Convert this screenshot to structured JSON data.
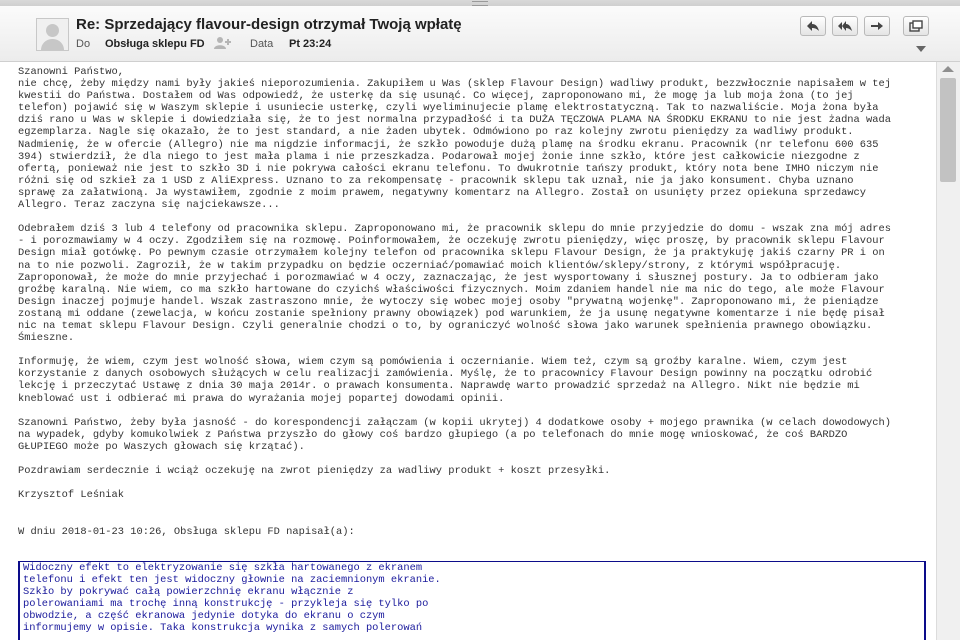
{
  "header": {
    "subject": "Re: Sprzedający flavour-design otrzymał Twoją wpłatę",
    "to_label": "Do",
    "to_value": "Obsługa sklepu FD",
    "date_label": "Data",
    "date_value": "Pt 23:24"
  },
  "toolbar": {
    "buttons": [
      "reply-icon",
      "reply-all-icon",
      "forward-icon",
      "new-window-icon"
    ],
    "menu": "chevron-down-icon"
  },
  "message": {
    "lines": [
      "Szanowni Państwo,",
      "nie chcę, żeby między nami były jakieś nieporozumienia. Zakupiłem u Was (sklep Flavour Design) wadliwy produkt, bezzwłocznie napisałem w tej",
      "kwestii do Państwa. Dostałem od Was odpowiedź, że usterkę da się usunąć. Co więcej, zaproponowano mi, że mogę ja lub moja żona (to jej",
      "telefon) pojawić się w Waszym sklepie i usuniecie usterkę, czyli wyeliminujecie plamę elektrostatyczną. Tak to nazwaliście. Moja żona była",
      "dziś rano u Was w sklepie i dowiedziała się, że to jest normalna przypadłość i ta DUŻA TĘCZOWA PLAMA NA ŚRODKU EKRANU to nie jest żadna wada",
      "egzemplarza. Nagle się okazało, że to jest standard, a nie żaden ubytek. Odmówiono po raz kolejny zwrotu pieniędzy za wadliwy produkt.",
      "Nadmienię, że w ofercie (Allegro) nie ma nigdzie informacji, że szkło powoduje dużą plamę na środku ekranu. Pracownik (nr telefonu 600 635",
      "394) stwierdził, że dla niego to jest mała plama i nie przeszkadza. Podarował mojej żonie inne szkło, które jest całkowicie niezgodne z",
      "ofertą, ponieważ nie jest to szkło 3D i nie pokrywa całości ekranu telefonu. To dwukrotnie tańszy produkt, który nota bene IMHO niczym nie",
      "różni się od szkieł za 1 USD z AliExpress. Uznano to za rekompensatę - pracownik sklepu tak uznał, nie ja jako konsument. Chyba uznano",
      "sprawę za załatwioną. Ja wystawiłem, zgodnie z moim prawem, negatywny komentarz na Allegro. Został on usunięty przez opiekuna sprzedawcy",
      "Allegro. Teraz zaczyna się najciekawsze...",
      "",
      "Odebrałem dziś 3 lub 4 telefony od pracownika sklepu. Zaproponowano mi, że pracownik sklepu do mnie przyjedzie do domu - wszak zna mój adres",
      "- i porozmawiamy w 4 oczy. Zgodziłem się na rozmowę. Poinformowałem, że oczekuję zwrotu pieniędzy, więc proszę, by pracownik sklepu Flavour",
      "Design miał gotówkę. Po pewnym czasie otrzymałem kolejny telefon od pracownika sklepu Flavour Design, że ja praktykuję jakiś czarny PR i on",
      "na to nie pozwoli. Zagroził, że w takim przypadku on będzie oczerniać/pomawiać moich klientów/sklepy/strony, z którymi współpracuję.",
      "Zaproponował, że może do mnie przyjechać i porozmawiać w 4 oczy, zaznaczając, że jest wysportowany i słusznej postury. Ja to odbieram jako",
      "groźbę karalną. Nie wiem, co ma szkło hartowane do czyichś właściwości fizycznych. Moim zdaniem handel nie ma nic do tego, ale może Flavour",
      "Design inaczej pojmuje handel. Wszak zastraszono mnie, że wytoczy się wobec mojej osoby \"prywatną wojenkę\". Zaproponowano mi, że pieniądze",
      "zostaną mi oddane (zewelacja, w końcu zostanie spełniony prawny obowiązek) pod warunkiem, że ja usunę negatywne komentarze i nie będę pisał",
      "nic na temat sklepu Flavour Design. Czyli generalnie chodzi o to, by ograniczyć wolność słowa jako warunek spełnienia prawnego obowiązku.",
      "Śmieszne.",
      "",
      "Informuję, że wiem, czym jest wolność słowa, wiem czym są pomówienia i oczernianie. Wiem też, czym są groźby karalne. Wiem, czym jest",
      "korzystanie z danych osobowych służących w celu realizacji zamówienia. Myślę, że to pracownicy Flavour Design powinny na początku odrobić",
      "lekcję i przeczytać Ustawę z dnia 30 maja 2014r. o prawach konsumenta. Naprawdę warto prowadzić sprzedaż na Allegro. Nikt nie będzie mi",
      "kneblować ust i odbierać mi prawa do wyrażania mojej popartej dowodami opinii.",
      "",
      "Szanowni Państwo, żeby była jasność - do korespondencji załączam (w kopii ukrytej) 4 dodatkowe osoby + mojego prawnika (w celach dowodowych)",
      "na wypadek, gdyby komukolwiek z Państwa przyszło do głowy coś bardzo głupiego (a po telefonach do mnie mogę wnioskować, że coś BARDZO",
      "GŁUPIEGO może po Waszych głowach się krzątać).",
      "",
      "Pozdrawiam serdecznie i wciąż oczekuję na zwrot pieniędzy za wadliwy produkt + koszt przesyłki.",
      "",
      "Krzysztof Leśniak",
      "",
      "",
      "W dniu 2018-01-23 10:26, Obsługa sklepu FD napisał(a):"
    ],
    "quote_lines": [
      "Widoczny efekt to elektryzowanie się szkła hartowanego z ekranem",
      "telefonu i efekt ten jest widoczny głownie na zaciemnionym ekranie.",
      "Szkło by pokrywać całą powierzchnię ekranu włącznie z",
      "polerowaniami ma trochę inną konstrukcję - przykleja się tylko po",
      "obwodzie, a część ekranowa jedynie dotyka do ekranu o czym",
      "informujemy w opisie. Taka konstrukcja wynika z samych polerowań"
    ]
  },
  "colors": {
    "quote_text": "#1a1a9c",
    "quote_border": "#0c0c8a",
    "body_text": "#333333"
  }
}
